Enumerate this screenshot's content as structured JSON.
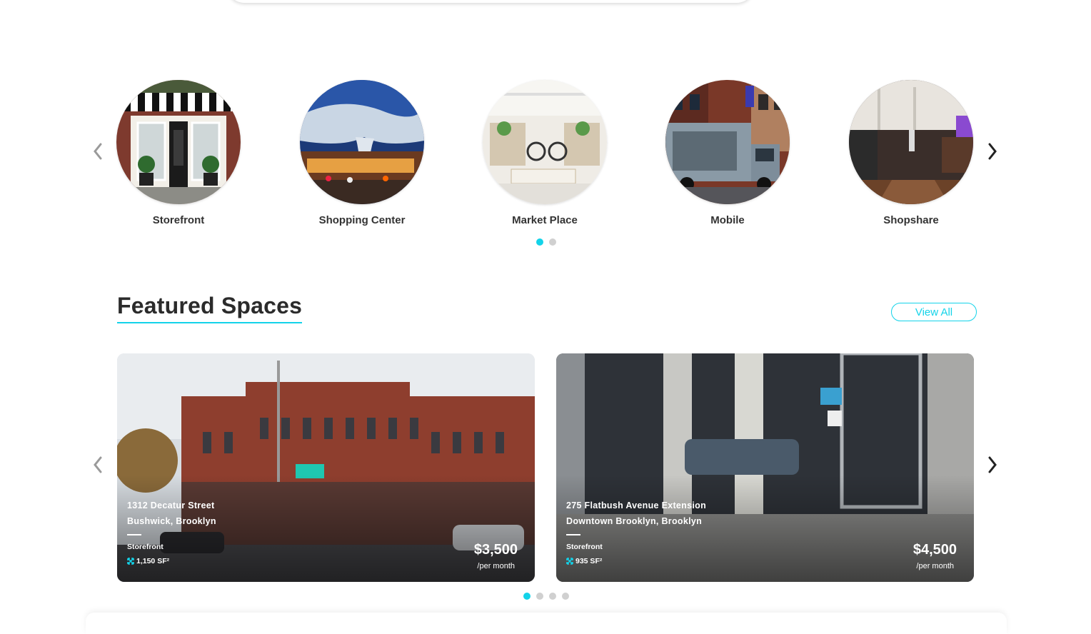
{
  "categories": {
    "items": [
      {
        "label": "Storefront"
      },
      {
        "label": "Shopping Center"
      },
      {
        "label": "Market Place"
      },
      {
        "label": "Mobile"
      },
      {
        "label": "Shopshare"
      }
    ],
    "pagination": {
      "count": 2,
      "active": 0
    }
  },
  "featured": {
    "title": "Featured Spaces",
    "view_all_label": "View All",
    "cards": [
      {
        "street": "1312 Decatur Street",
        "area": "Bushwick, Brooklyn",
        "type": "Storefront",
        "size": "1,150 SF²",
        "price": "$3,500",
        "period": "/per month"
      },
      {
        "street": "275 Flatbush Avenue Extension",
        "area": "Downtown Brooklyn, Brooklyn",
        "type": "Storefront",
        "size": "935 SF²",
        "period": "/per month",
        "price": "$4,500"
      }
    ],
    "pagination": {
      "count": 4,
      "active": 0
    }
  },
  "colors": {
    "accent": "#13d3e9",
    "text": "#2b2b2b"
  },
  "icons": {
    "prev": "chevron-left-icon",
    "next": "chevron-right-icon",
    "size": "expand-arrows-icon"
  }
}
